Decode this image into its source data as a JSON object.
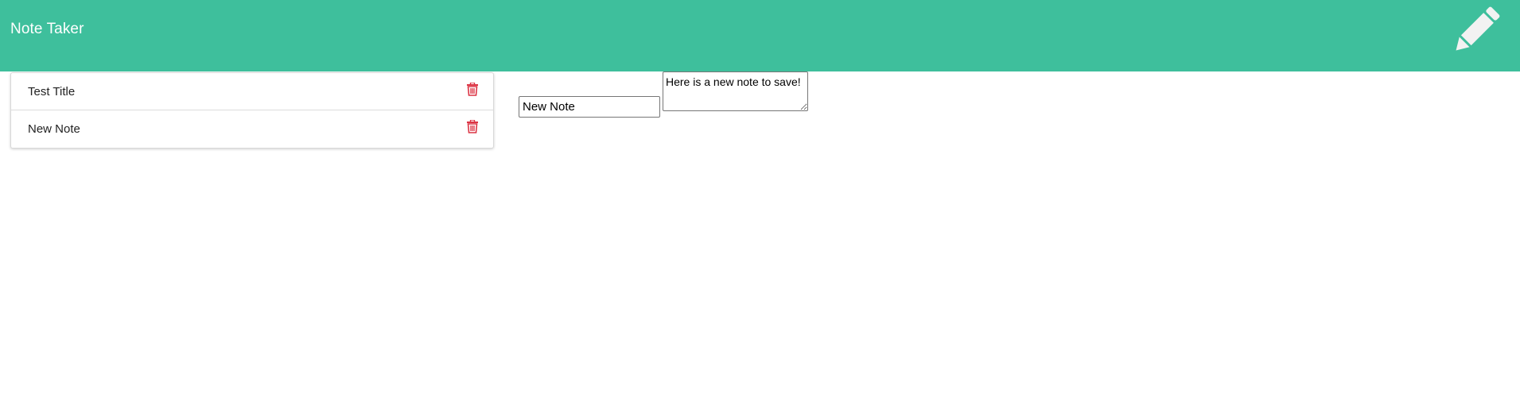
{
  "navbar": {
    "brand": "Note Taker",
    "background_color": "#3ebf9c",
    "new_note_icon": "pencil-icon"
  },
  "notes_list": {
    "items": [
      {
        "title": "Test Title",
        "delete_icon": "trash-icon"
      },
      {
        "title": "New Note",
        "delete_icon": "trash-icon"
      }
    ],
    "delete_color": "#dc3545"
  },
  "editor": {
    "title_value": "New Note",
    "text_value": "Here is a new note to save!"
  }
}
